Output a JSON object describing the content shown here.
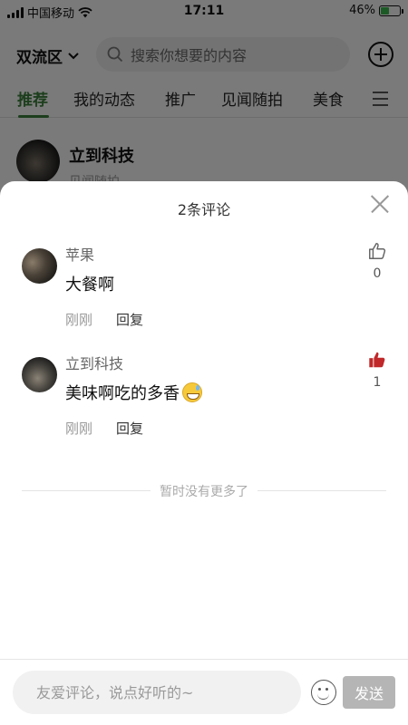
{
  "status_bar": {
    "carrier": "中国移动",
    "time": "17:11",
    "battery_percent": "46%",
    "battery_level": 0.46
  },
  "header": {
    "location": "双流区",
    "search_placeholder": "搜索你想要的内容"
  },
  "tabs": [
    {
      "label": "推荐",
      "active": true
    },
    {
      "label": "我的动态"
    },
    {
      "label": "推广"
    },
    {
      "label": "见闻随拍"
    },
    {
      "label": "美食"
    }
  ],
  "feed": {
    "author": "立到科技",
    "category": "见闻随拍"
  },
  "comments_sheet": {
    "title": "2条评论",
    "comments": [
      {
        "author": "苹果",
        "text": "大餐啊",
        "time": "刚刚",
        "reply": "回复",
        "likes": "0",
        "liked": false
      },
      {
        "author": "立到科技",
        "text": "美味啊吃的多香",
        "emoji": "grinning-sweat-emoji",
        "time": "刚刚",
        "reply": "回复",
        "likes": "1",
        "liked": true
      }
    ],
    "end_text": "暂时没有更多了"
  },
  "input_bar": {
    "placeholder": "友爱评论，说点好听的~",
    "send_label": "发送"
  },
  "colors": {
    "accent_green": "#3a7d3a",
    "liked_red": "#c0282a",
    "send_disabled": "#b5b5b5"
  }
}
